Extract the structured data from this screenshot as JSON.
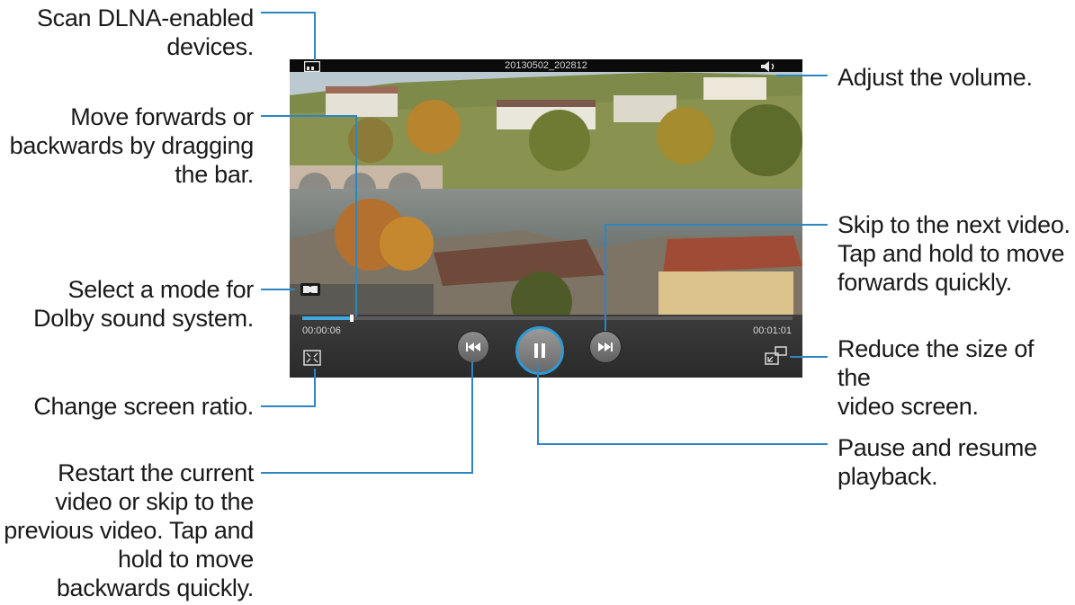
{
  "player": {
    "video_title": "20130502_202812",
    "elapsed_time": "00:00:06",
    "total_time": "00:01:01",
    "progress_fraction": 0.1,
    "accent_color": "#41a9de"
  },
  "annotations": {
    "scan_dlna": "Scan DLNA-enabled\ndevices.",
    "seek_bar": "Move forwards or\nbackwards by dragging\nthe bar.",
    "dolby_mode": "Select a mode for\nDolby sound system.",
    "screen_ratio": "Change screen ratio.",
    "previous": "Restart the current\nvideo or skip to the\nprevious video. Tap and\nhold to move\nbackwards quickly.",
    "volume": "Adjust the volume.",
    "next": "Skip to the next video.\nTap and hold to move\nforwards quickly.",
    "popup": "Reduce the size of the\nvideo screen.",
    "pause": "Pause and resume\nplayback."
  },
  "icons": {
    "dlna": "dlna-icon",
    "volume": "speaker-icon",
    "dolby": "dolby-icon",
    "ratio": "screen-ratio-icon",
    "popup": "popup-player-icon",
    "previous": "skip-previous-icon",
    "pause": "pause-icon",
    "next": "skip-next-icon"
  }
}
